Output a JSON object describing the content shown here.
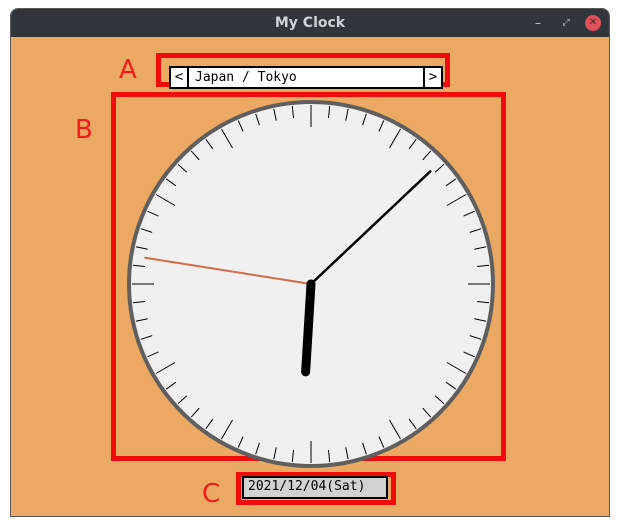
{
  "window": {
    "title": "My Clock",
    "minimize_glyph": "–",
    "maximize_glyph": "⤢",
    "close_glyph": "✕"
  },
  "annotations": {
    "a": "A",
    "b": "B",
    "c": "C"
  },
  "timezone": {
    "prev_glyph": "<",
    "next_glyph": ">",
    "label": "Japan / Tokyo"
  },
  "clock": {
    "hour": 6,
    "minute": 7,
    "second": 46.5,
    "hand_colors": {
      "hour": "#000000",
      "minute": "#000000",
      "second": "#cf6d4a"
    },
    "face_color": "#f0f0f0",
    "rim_color": "#5f5f5f"
  },
  "date": {
    "text": "2021/12/04(Sat)"
  },
  "colors": {
    "background": "#eba964",
    "annotation_red": "#f10c0c"
  }
}
